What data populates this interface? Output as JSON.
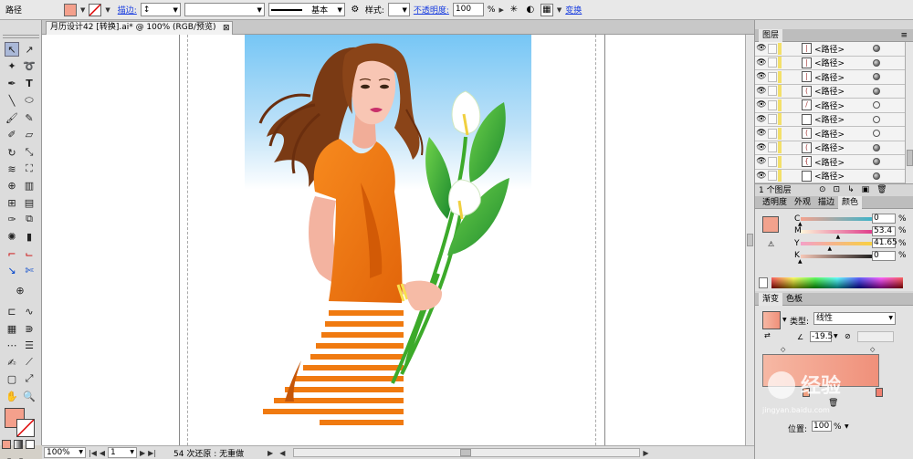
{
  "control_bar": {
    "object_type": "路径",
    "stroke_label": "描边:",
    "stroke_style": "基本",
    "style_label": "样式:",
    "opacity_label": "不透明度:",
    "opacity_value": "100",
    "opacity_unit": "%",
    "transform_label": "变换"
  },
  "document": {
    "tab_title": "月历设计42 [转换].ai* @ 100% (RGB/预览)"
  },
  "status_bar": {
    "zoom": "100%",
    "artboard": "1",
    "message": "54 次还原 : 无重做"
  },
  "layers_panel": {
    "title": "图层",
    "items": [
      {
        "name": "<路径>",
        "target": "filled",
        "thumb": "|"
      },
      {
        "name": "<路径>",
        "target": "filled",
        "thumb": "|"
      },
      {
        "name": "<路径>",
        "target": "filled",
        "thumb": "|"
      },
      {
        "name": "<路径>",
        "target": "filled",
        "thumb": "("
      },
      {
        "name": "<路径>",
        "target": "empty",
        "thumb": "/"
      },
      {
        "name": "<路径>",
        "target": "empty",
        "thumb": ""
      },
      {
        "name": "<路径>",
        "target": "empty",
        "thumb": "("
      },
      {
        "name": "<路径>",
        "target": "filled",
        "thumb": "("
      },
      {
        "name": "<路径>",
        "target": "filled",
        "thumb": "{"
      },
      {
        "name": "<路径>",
        "target": "filled",
        "thumb": ""
      }
    ],
    "footer": "1 个图层"
  },
  "color_panel": {
    "tabs": [
      "透明度",
      "外观",
      "描边",
      "颜色"
    ],
    "active_tab": "颜色",
    "swatch": "#f2a28d",
    "rows": [
      {
        "label": "C",
        "value": "0",
        "unit": "%",
        "knob": 0.0,
        "gradient": "linear-gradient(90deg,#f4a28e,#3fb3c8)"
      },
      {
        "label": "M",
        "value": "53.4",
        "unit": "%",
        "knob": 0.534,
        "gradient": "linear-gradient(90deg,#fdf5d8,#e03d8c)"
      },
      {
        "label": "Y",
        "value": "41.65",
        "unit": "%",
        "knob": 0.4165,
        "gradient": "linear-gradient(90deg,#f4a0c8,#f8d040)"
      },
      {
        "label": "K",
        "value": "0",
        "unit": "%",
        "knob": 0.0,
        "gradient": "linear-gradient(90deg,#f6c8b8,#222222)"
      }
    ]
  },
  "gradient_panel": {
    "tabs": [
      "渐变",
      "色板"
    ],
    "active_tab": "渐变",
    "type_label": "类型:",
    "type_value": "线性",
    "angle_value": "-19.5",
    "location_label": "位置:",
    "location_value": "100",
    "location_unit": "%",
    "gradient_start": "#f6b8a4",
    "gradient_end": "#f0907a"
  },
  "watermark": {
    "text": "经验",
    "subtext": "jingyan.baidu.com"
  },
  "colors": {
    "fill": "#f4a08c",
    "sky": "#7ec8f4"
  }
}
